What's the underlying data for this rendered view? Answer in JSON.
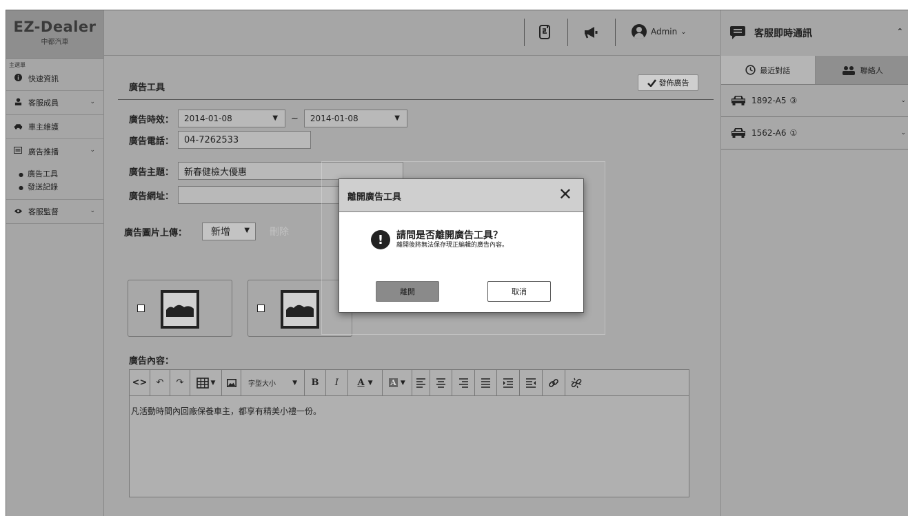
{
  "brand": {
    "name": "EZ-Dealer",
    "subtitle": "中都汽車"
  },
  "sidebar": {
    "caption": "主選單",
    "items": [
      {
        "label": "快速資訊",
        "icon": "info-icon"
      },
      {
        "label": "客服成員",
        "icon": "person-icon"
      },
      {
        "label": "車主維護",
        "icon": "car-icon"
      },
      {
        "label": "廣告推播",
        "icon": "ad-icon"
      },
      {
        "label": "客服監督",
        "icon": "eye-icon"
      }
    ],
    "sub_items": [
      "廣告工具",
      "發送記錄"
    ]
  },
  "topbar": {
    "user": "Admin"
  },
  "page": {
    "title": "廣告工具",
    "publish_label": "發佈廣告"
  },
  "form": {
    "period_label": "廣告時效：",
    "date_from": "2014-01-08",
    "date_sep": "~",
    "date_to": "2014-01-08",
    "phone_label": "廣告電話：",
    "phone_value": "04-7262533",
    "subject_label": "廣告主題：",
    "subject_value": "新春健檢大優惠",
    "url_label": "廣告網址：",
    "url_value": "",
    "upload_label": "廣告圖片上傳：",
    "add_label": "新增",
    "delete_label": "刪除",
    "content_label": "廣告內容：",
    "font_size_label": "字型大小",
    "content_text": "凡活動時間內回廠保養車主，都享有精美小禮一份。"
  },
  "chat": {
    "title": "客服即時通訊",
    "tab_recent": "最近對話",
    "tab_contacts": "聯絡人",
    "conversations": [
      {
        "plate": "1892-A5",
        "count": "③"
      },
      {
        "plate": "1562-A6",
        "count": "①"
      }
    ]
  },
  "modal": {
    "title": "離開廣告工具",
    "question": "請問是否離開廣告工具？",
    "note": "離開後將無法保存現正編輯的廣告內容。",
    "leave_label": "離開",
    "cancel_label": "取消"
  }
}
